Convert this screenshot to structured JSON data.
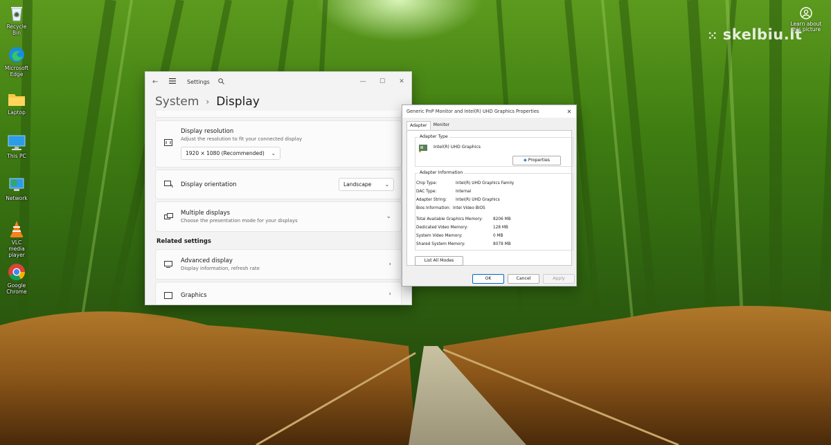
{
  "desktop": {
    "icons": [
      {
        "label": "Recycle Bin",
        "icon": "recycle-bin-icon"
      },
      {
        "label": "Microsoft Edge",
        "icon": "edge-icon"
      },
      {
        "label": "Laptop",
        "icon": "folder-icon"
      },
      {
        "label": "This PC",
        "icon": "monitor-icon"
      },
      {
        "label": "Network",
        "icon": "network-icon"
      },
      {
        "label": "VLC media player",
        "icon": "vlc-icon"
      },
      {
        "label": "Google Chrome",
        "icon": "chrome-icon"
      }
    ],
    "learn_label": "Learn about this picture",
    "watermark": "skelbiu.lt"
  },
  "settings": {
    "title": "Settings",
    "breadcrumb_parent": "System",
    "breadcrumb_separator": "›",
    "breadcrumb_current": "Display",
    "resolution": {
      "title": "Display resolution",
      "subtitle": "Adjust the resolution to fit your connected display",
      "value": "1920 × 1080 (Recommended)"
    },
    "orientation": {
      "title": "Display orientation",
      "value": "Landscape"
    },
    "multiple": {
      "title": "Multiple displays",
      "subtitle": "Choose the presentation mode for your displays"
    },
    "related_heading": "Related settings",
    "advanced": {
      "title": "Advanced display",
      "subtitle": "Display information, refresh rate"
    },
    "graphics": {
      "title": "Graphics"
    }
  },
  "props": {
    "title": "Generic PnP Monitor and Intel(R) UHD Graphics Properties",
    "tabs": [
      "Adapter",
      "Monitor"
    ],
    "adapter_type_heading": "Adapter Type",
    "adapter_name": "Intel(R) UHD Graphics",
    "properties_button": "Properties",
    "adapter_info_heading": "Adapter Information",
    "info": [
      {
        "key": "Chip Type:",
        "value": "Intel(R) UHD Graphics Family"
      },
      {
        "key": "DAC Type:",
        "value": "Internal"
      },
      {
        "key": "Adapter String:",
        "value": "Intel(R) UHD Graphics"
      },
      {
        "key": "Bios Information:",
        "value": "Intel Video BIOS"
      }
    ],
    "memory": [
      {
        "key": "Total Available Graphics Memory:",
        "value": "8206 MB"
      },
      {
        "key": "Dedicated Video Memory:",
        "value": "128 MB"
      },
      {
        "key": "System Video Memory:",
        "value": "0 MB"
      },
      {
        "key": "Shared System Memory:",
        "value": "8078 MB"
      }
    ],
    "list_modes_button": "List All Modes",
    "ok": "OK",
    "cancel": "Cancel",
    "apply": "Apply"
  }
}
